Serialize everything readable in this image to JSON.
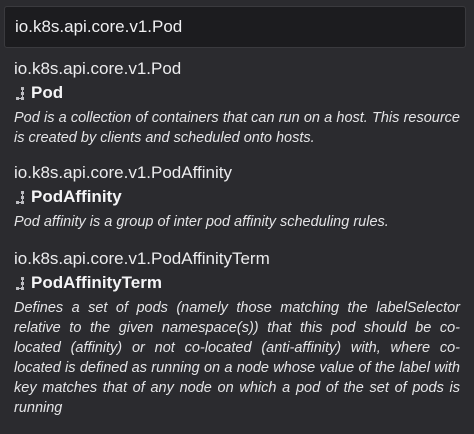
{
  "search": {
    "value": "io.k8s.api.core.v1.Pod"
  },
  "results": [
    {
      "path": "io.k8s.api.core.v1.Pod",
      "icon": "tree-structure-icon",
      "name": "Pod",
      "description": "Pod is a collection of containers that can run on a host. This resource is created by clients and scheduled onto hosts."
    },
    {
      "path": "io.k8s.api.core.v1.PodAffinity",
      "icon": "tree-structure-icon",
      "name": "PodAffinity",
      "description": "Pod affinity is a group of inter pod affinity scheduling rules."
    },
    {
      "path": "io.k8s.api.core.v1.PodAffinityTerm",
      "icon": "tree-structure-icon",
      "name": "PodAffinityTerm",
      "description": "Defines a set of pods (namely those matching the labelSelector relative to the given namespace(s)) that this pod should be co-located (affinity) or not co-located (anti-affinity) with, where co-located is defined as running on a node whose value of the label with key matches that of any node on which a pod of the set of pods is running"
    }
  ]
}
